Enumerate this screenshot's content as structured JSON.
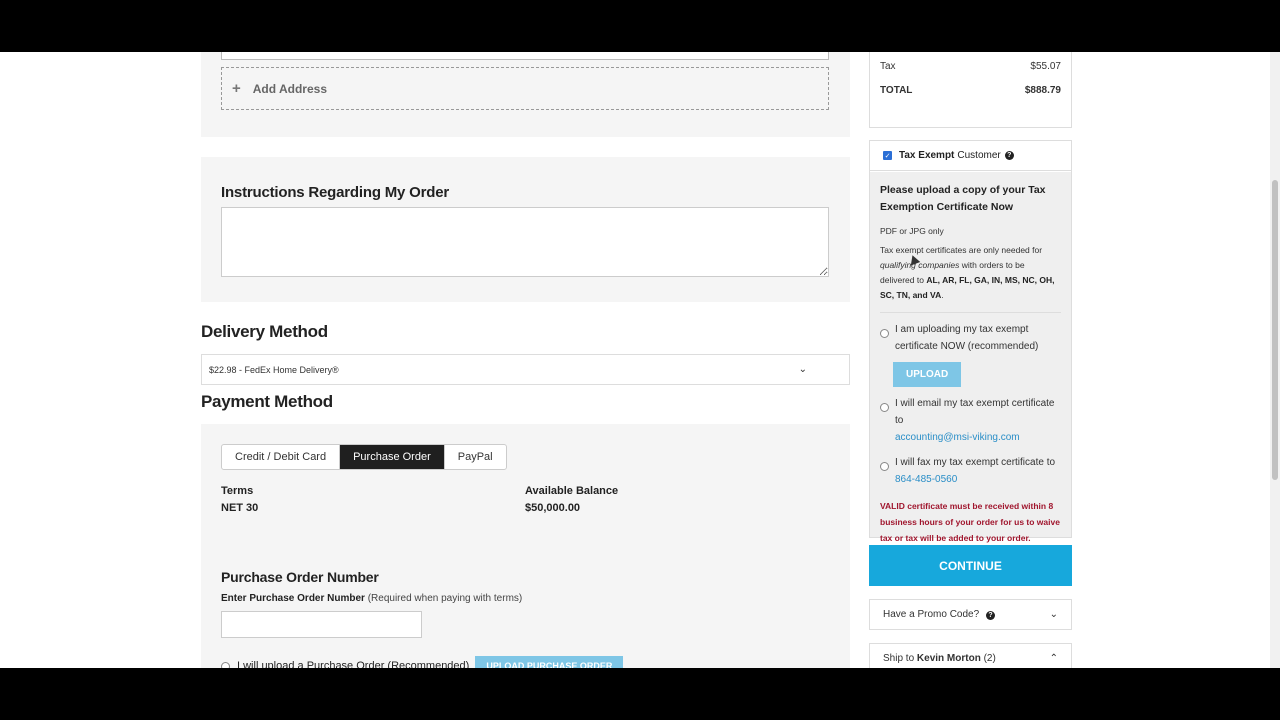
{
  "address": {
    "add_address_label": "Add Address"
  },
  "instructions": {
    "title": "Instructions Regarding My Order",
    "value": ""
  },
  "delivery": {
    "title": "Delivery Method",
    "selected": "$22.98 - FedEx Home Delivery®"
  },
  "payment": {
    "title": "Payment Method",
    "tabs": [
      {
        "label": "Credit / Debit Card",
        "active": false
      },
      {
        "label": "Purchase Order",
        "active": true
      },
      {
        "label": "PayPal",
        "active": false
      }
    ],
    "terms_label": "Terms",
    "terms_value": "NET 30",
    "balance_label": "Available Balance",
    "balance_value": "$50,000.00",
    "po_title": "Purchase Order Number",
    "po_field_label": "Enter Purchase Order Number",
    "po_field_hint": "(Required when paying with terms)",
    "po_value": "",
    "po_upload_option": "I will upload a Purchase Order (Recommended)",
    "po_upload_button": "UPLOAD PURCHASE ORDER"
  },
  "summary": {
    "tax_label": "Tax",
    "tax_value": "$55.07",
    "total_label": "TOTAL",
    "total_value": "$888.79"
  },
  "tax_exempt": {
    "checked": true,
    "label_strong": "Tax Exempt",
    "label_rest": "Customer",
    "heading": "Please upload a copy of your Tax Exemption Certificate Now",
    "file_types": "PDF or JPG only",
    "note_prefix": "Tax exempt certificates are only needed for",
    "note_italic": "qualifying companies",
    "note_mid": "with orders to be delivered to",
    "note_states": "AL, AR, FL, GA, IN, MS, NC, OH, SC, TN, and VA",
    "note_end": ".",
    "option_upload": "I am uploading my tax exempt certificate NOW (recommended)",
    "upload_button": "UPLOAD",
    "option_email": "I will email my tax exempt certificate to",
    "email": "accounting@msi-viking.com",
    "option_fax": "I will fax my tax exempt certificate to",
    "fax": "864-485-0560",
    "warning": "VALID certificate must be received within 8 business hours of your order for us to waive tax or tax will be added to your order."
  },
  "continue_label": "CONTINUE",
  "promo": {
    "label": "Have a Promo Code?"
  },
  "ship_to": {
    "prefix": "Ship to",
    "name": "Kevin Morton",
    "count": "(2)"
  },
  "colors": {
    "accent": "#17a8dc",
    "button_light": "#7ec6e6",
    "warning": "#a0152d",
    "link": "#2a8ec7"
  }
}
